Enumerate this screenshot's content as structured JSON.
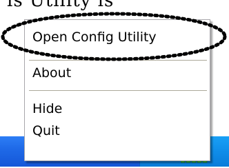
{
  "background": {
    "partial_text": "is Utility is"
  },
  "context_menu": {
    "items": [
      {
        "label": "Open Config Utility"
      },
      {
        "label": "About"
      },
      {
        "label": "Hide"
      },
      {
        "label": "Quit"
      }
    ]
  },
  "taskbar": {
    "color": "#1f6ae8",
    "tray_color": "#0f8de9",
    "tray_icons": [
      "show-hidden-icons-chevron-icon",
      "network-connection-icon",
      "wireless-signal-icon"
    ]
  },
  "colors": {
    "menu_background": "#ffffff",
    "menu_border": "#a7a6aa",
    "separator": "#aca899",
    "signal_green": "#3cc23c"
  }
}
